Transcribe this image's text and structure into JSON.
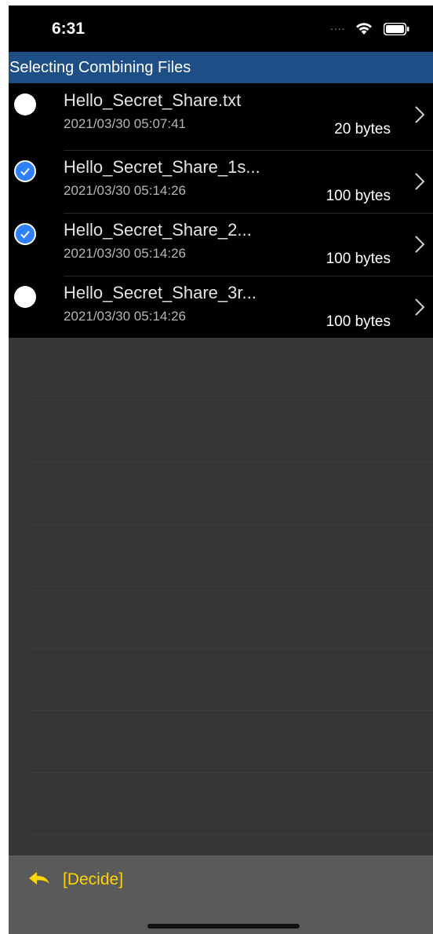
{
  "status_bar": {
    "time": "6:31",
    "signal_dots": "....",
    "wifi_icon": "wifi-icon",
    "battery_icon": "battery-icon"
  },
  "header": {
    "title": "Selecting Combining Files",
    "color": "#1e4e86"
  },
  "files": [
    {
      "name": "Hello_Secret_Share.txt",
      "date": "2021/03/30  05:07:41",
      "size": "20 bytes",
      "selected": false
    },
    {
      "name": "Hello_Secret_Share_1s...",
      "date": "2021/03/30  05:14:26",
      "size": "100 bytes",
      "selected": true
    },
    {
      "name": "Hello_Secret_Share_2...",
      "date": "2021/03/30  05:14:26",
      "size": "100 bytes",
      "selected": true
    },
    {
      "name": "Hello_Secret_Share_3r...",
      "date": "2021/03/30  05:14:26",
      "size": "100 bytes",
      "selected": false
    }
  ],
  "toolbar": {
    "decide_label": "[Decide]",
    "decide_icon": "reply-arrow-icon",
    "accent_color": "#ffd400"
  },
  "colors": {
    "check_on": "#2f80ff",
    "list_background": "#000000",
    "empty_background": "#363636"
  }
}
